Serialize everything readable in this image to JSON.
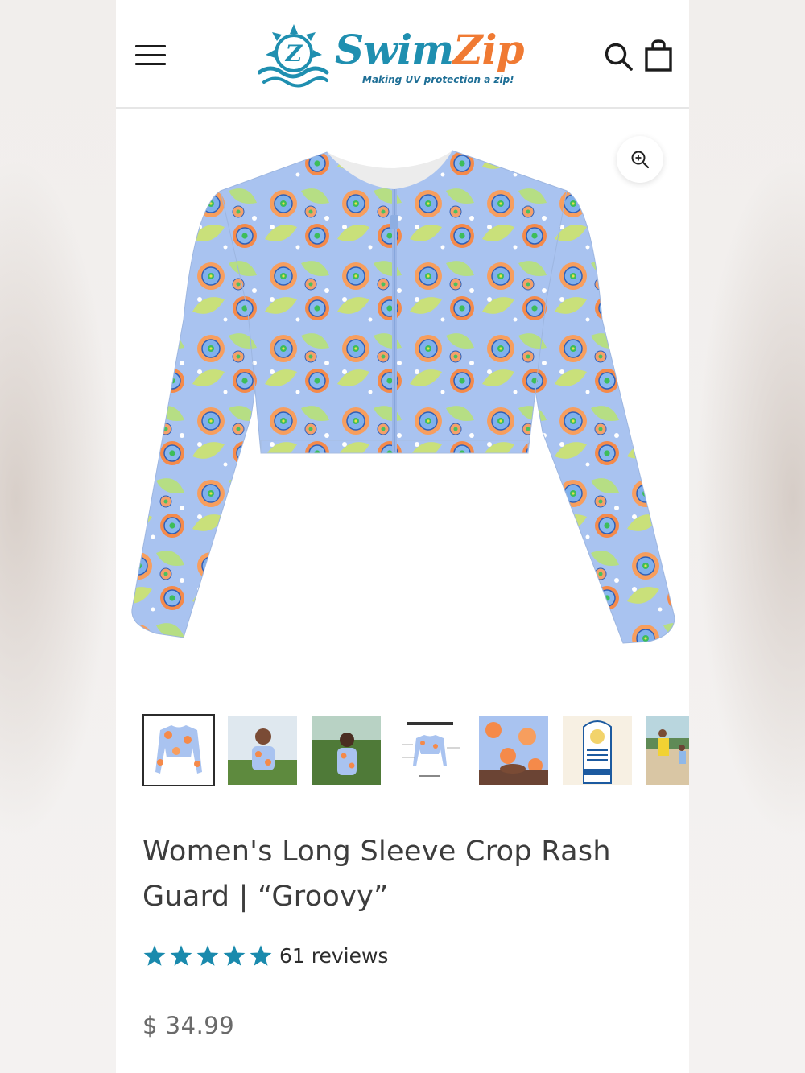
{
  "brand": {
    "name_part1": "Swim",
    "name_part2": "Zip",
    "tagline": "Making UV protection a zip!",
    "badge_letter": "Z"
  },
  "colors": {
    "accent_blue": "#1f8fb0",
    "accent_orange": "#f07a33",
    "star": "#1a8aad",
    "shirt_base": "#a9c3f0"
  },
  "header": {
    "menu_icon": "hamburger-icon",
    "search_icon": "search-icon",
    "cart_icon": "shopping-bag-icon"
  },
  "gallery": {
    "zoom_icon": "zoom-in-icon",
    "thumbnails": [
      {
        "name": "thumb-product-front",
        "selected": true
      },
      {
        "name": "thumb-model-beach"
      },
      {
        "name": "thumb-model-garden"
      },
      {
        "name": "thumb-features-diagram",
        "caption": "UPF 50+ CROP RASH GUARD"
      },
      {
        "name": "thumb-model-closeup"
      },
      {
        "name": "thumb-seal-of-recommendation",
        "caption": "SEAL OF RECOMMENDATION"
      },
      {
        "name": "thumb-family-beach"
      }
    ]
  },
  "product": {
    "title": "Women's Long Sleeve Crop Rash Guard | “Groovy”",
    "rating": 5,
    "reviews_label": "61 reviews",
    "price": "$ 34.99"
  }
}
